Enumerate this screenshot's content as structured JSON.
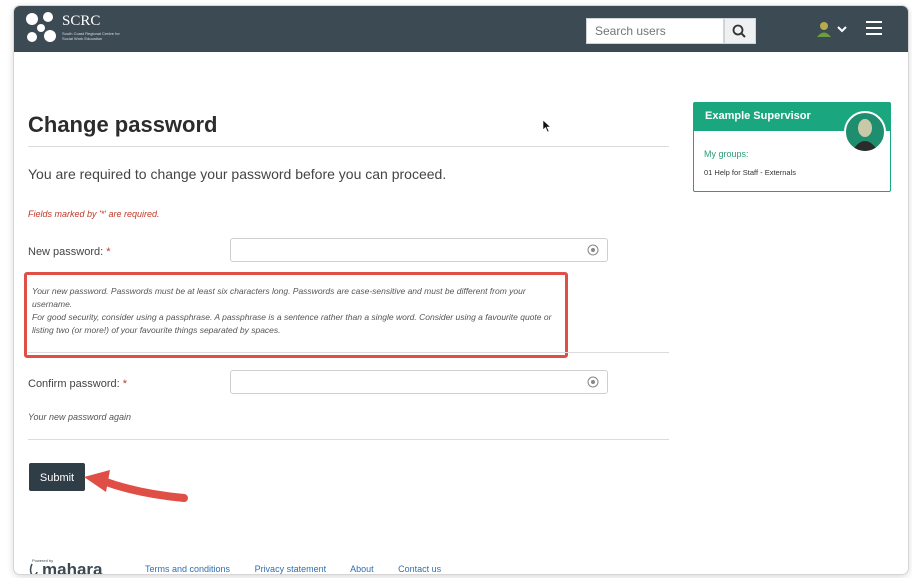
{
  "header": {
    "logo_title": "SCRC",
    "logo_subtitle": "South Coast Regional Centre for Social Work Education",
    "search": {
      "placeholder": "Search users"
    },
    "user_menu_icon": "user-icon",
    "menu_icon": "hamburger-icon"
  },
  "main": {
    "page_title": "Change password",
    "intro": "You are required to change your password before you can proceed.",
    "required_note": "Fields marked by '*' are required.",
    "new_password": {
      "label": "New password:",
      "required_mark": "*",
      "value": "",
      "description_line1": "Your new password. Passwords must be at least six characters long. Passwords are case-sensitive and must be different from your username.",
      "description_line2": "For good security, consider using a passphrase. A passphrase is a sentence rather than a single word. Consider using a favourite quote or listing two (or more!) of your favourite things separated by spaces."
    },
    "confirm_password": {
      "label": "Confirm password:",
      "required_mark": "*",
      "value": "",
      "description": "Your new password again"
    },
    "submit_label": "Submit"
  },
  "sidebar": {
    "title": "Example Supervisor",
    "groups_label": "My groups:",
    "groups": [
      "01 Help for Staff - Externals"
    ]
  },
  "footer": {
    "logo_text": "mahara",
    "powered_by": "Powered by",
    "links": [
      "Terms and conditions",
      "Privacy statement",
      "About",
      "Contact us"
    ]
  },
  "colors": {
    "topbar": "#3c4a54",
    "accent_green": "#1aa67e",
    "required_red": "#c0392b",
    "annotation_red": "#e04f46",
    "submit_bg": "#2f3d47",
    "link_blue": "#2f6fb0"
  }
}
